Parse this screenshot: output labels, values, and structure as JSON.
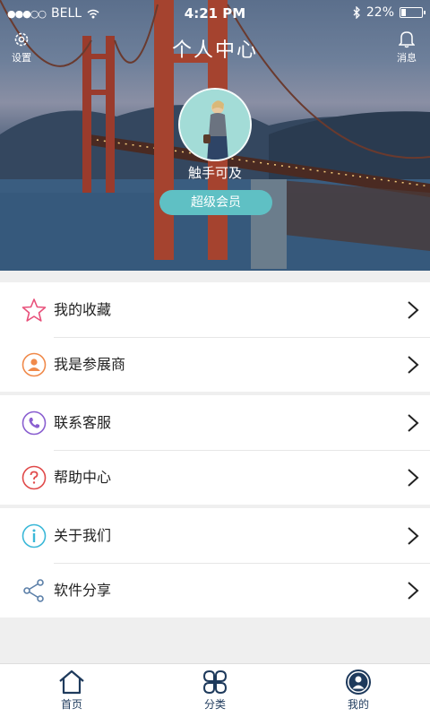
{
  "status_bar": {
    "signal": "●●●○○",
    "carrier": "BELL",
    "time": "4:21 PM",
    "battery_percent": "22%",
    "battery_level": 0.22
  },
  "header": {
    "title": "个人中心",
    "settings_label": "设置",
    "messages_label": "消息"
  },
  "profile": {
    "username": "触手可及",
    "badge": "超级会员"
  },
  "menu_groups": [
    {
      "items": [
        {
          "label": "我的收藏",
          "icon": "star-icon",
          "color": "#e8507a"
        },
        {
          "label": "我是参展商",
          "icon": "exhibitor-icon",
          "color": "#f08a4b"
        }
      ]
    },
    {
      "items": [
        {
          "label": "联系客服",
          "icon": "phone-icon",
          "color": "#8a5fd0"
        },
        {
          "label": "帮助中心",
          "icon": "question-icon",
          "color": "#e04a4a"
        }
      ]
    },
    {
      "items": [
        {
          "label": "关于我们",
          "icon": "info-icon",
          "color": "#3bb8d8"
        },
        {
          "label": "软件分享",
          "icon": "share-icon",
          "color": "#5b7fa8"
        }
      ]
    }
  ],
  "tabs": [
    {
      "label": "首页",
      "icon": "home-icon"
    },
    {
      "label": "分类",
      "icon": "category-icon"
    },
    {
      "label": "我的",
      "icon": "profile-icon",
      "active": true
    }
  ],
  "colors": {
    "accent": "#5fc0c4",
    "tab_icon": "#1e3a5c"
  }
}
